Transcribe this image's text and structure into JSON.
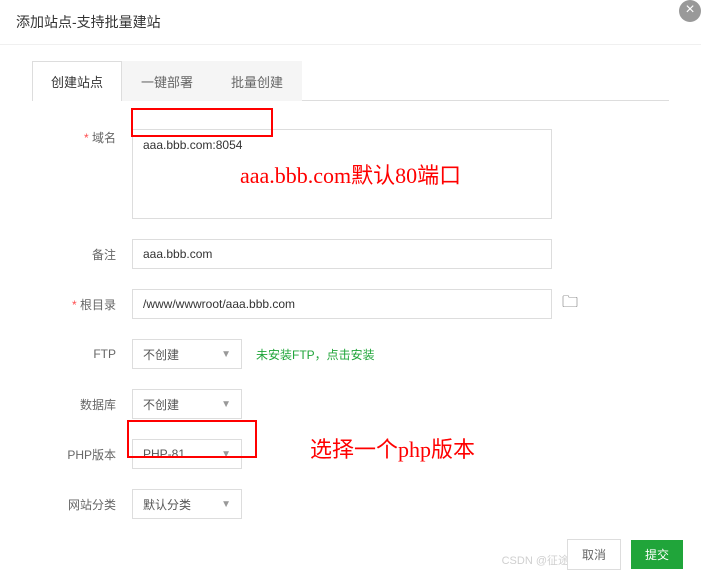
{
  "dialog": {
    "title": "添加站点-支持批量建站"
  },
  "tabs": {
    "create": "创建站点",
    "deploy": "一键部署",
    "batch": "批量创建"
  },
  "labels": {
    "domain": "域名",
    "remark": "备注",
    "rootdir": "根目录",
    "ftp": "FTP",
    "database": "数据库",
    "phpver": "PHP版本",
    "category": "网站分类"
  },
  "values": {
    "domain": "aaa.bbb.com:8054",
    "remark": "aaa.bbb.com",
    "rootdir": "/www/wwwroot/aaa.bbb.com",
    "ftp": "不创建",
    "database": "不创建",
    "phpver": "PHP-81",
    "category": "默认分类"
  },
  "hints": {
    "ftp": "未安装FTP，点击安装"
  },
  "annotations": {
    "domain_note": "aaa.bbb.com默认80端口",
    "php_note": "选择一个php版本"
  },
  "footer": {
    "cancel": "取消",
    "submit": "提交"
  },
  "watermark": "CSDN @征途黯然"
}
